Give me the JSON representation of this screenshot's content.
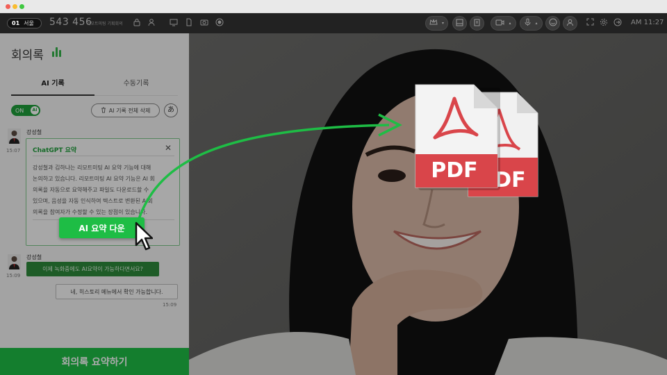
{
  "window": {
    "dots": [
      "#f25f57",
      "#f9bc2f",
      "#3fc840"
    ]
  },
  "topbar": {
    "room_number": "01",
    "room_location": "서울",
    "room_code": "543 456",
    "room_name": "리모트미팅 기획회의",
    "clock": "AM 11:27"
  },
  "sidebar": {
    "title": "회의록",
    "tabs": [
      {
        "label": "AI 기록"
      },
      {
        "label": "수동기록"
      }
    ],
    "toggle_label": "ON",
    "toggle_knob": "AI",
    "delete_label": "AI 기록 전체 삭제",
    "lang_label": "あ",
    "messages": [
      {
        "speaker": "강성철",
        "time": "15:07"
      },
      {
        "speaker": "강성철",
        "time": "15:09",
        "text": "이제 녹화중에도 AI요약이 가능하다면서요?"
      },
      {
        "time": "15:09",
        "text": "네, 히스토리 메뉴에서 확인 가능합니다."
      }
    ],
    "gpt_card": {
      "title": "ChatGPT 요약",
      "lines": [
        "강성철과 김하나는 리모트미팅 AI 요약 기능에 대해",
        "논의하고 있습니다. 리모트미팅 AI 요약 기능은 AI 회",
        "의록을 자동으로 요약해주고 파일도 다운로드할 수",
        "있으며, 음성을 자동 인식하여 텍스트로 변환된 AI회",
        "의록을 참여자가 수정할 수 있는 장점이 있습니다."
      ]
    },
    "summary_button": "회의록 요약하기"
  },
  "overlay": {
    "ai_download_button": "AI 요약 다운",
    "pdf_label": "PDF",
    "accent": "#1ebd45",
    "pdf_red": "#d9454a"
  }
}
